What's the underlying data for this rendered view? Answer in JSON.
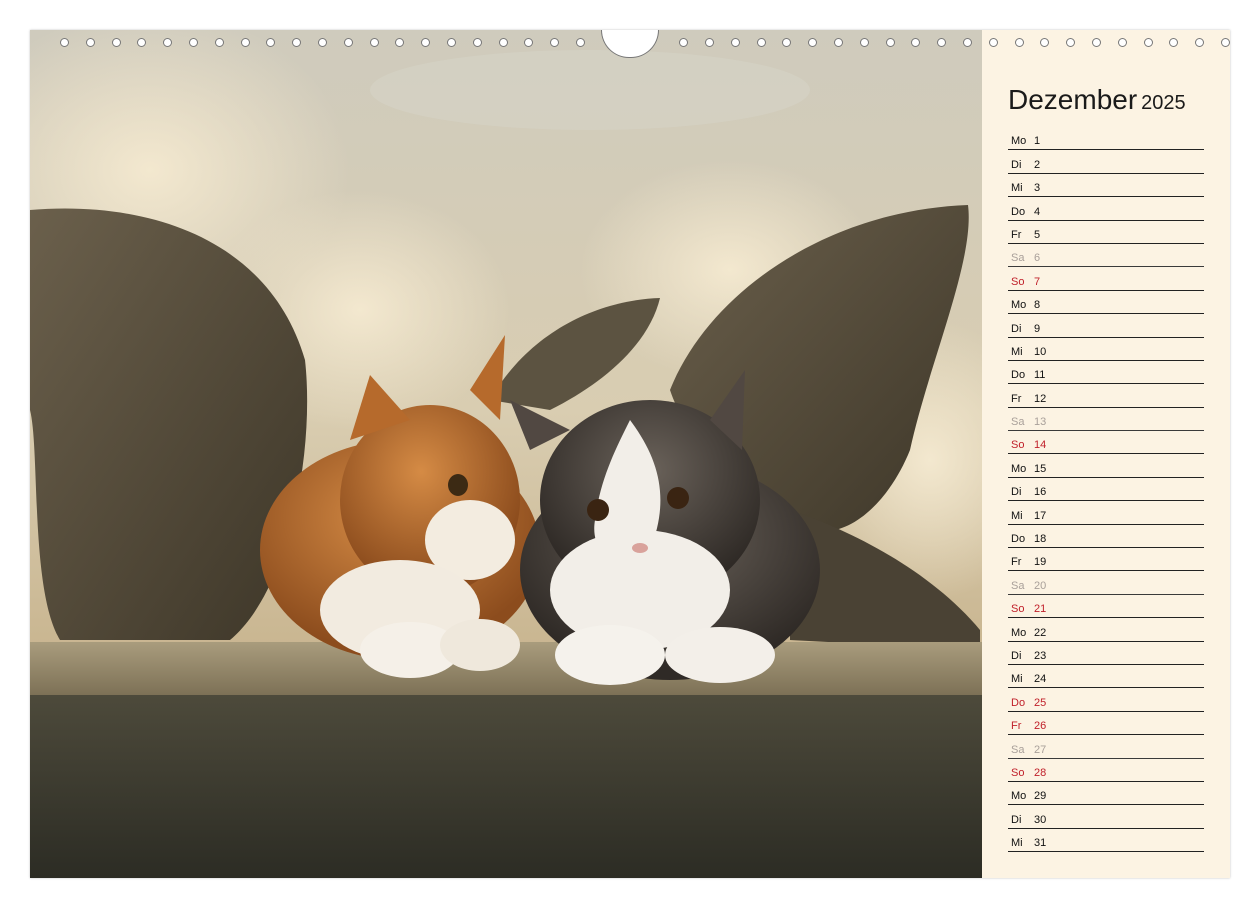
{
  "calendar": {
    "month": "Dezember",
    "year": "2025",
    "days": [
      {
        "wd": "Mo",
        "n": "1",
        "type": "normal"
      },
      {
        "wd": "Di",
        "n": "2",
        "type": "normal"
      },
      {
        "wd": "Mi",
        "n": "3",
        "type": "normal"
      },
      {
        "wd": "Do",
        "n": "4",
        "type": "normal"
      },
      {
        "wd": "Fr",
        "n": "5",
        "type": "normal"
      },
      {
        "wd": "Sa",
        "n": "6",
        "type": "sat"
      },
      {
        "wd": "So",
        "n": "7",
        "type": "red"
      },
      {
        "wd": "Mo",
        "n": "8",
        "type": "normal"
      },
      {
        "wd": "Di",
        "n": "9",
        "type": "normal"
      },
      {
        "wd": "Mi",
        "n": "10",
        "type": "normal"
      },
      {
        "wd": "Do",
        "n": "11",
        "type": "normal"
      },
      {
        "wd": "Fr",
        "n": "12",
        "type": "normal"
      },
      {
        "wd": "Sa",
        "n": "13",
        "type": "sat"
      },
      {
        "wd": "So",
        "n": "14",
        "type": "red"
      },
      {
        "wd": "Mo",
        "n": "15",
        "type": "normal"
      },
      {
        "wd": "Di",
        "n": "16",
        "type": "normal"
      },
      {
        "wd": "Mi",
        "n": "17",
        "type": "normal"
      },
      {
        "wd": "Do",
        "n": "18",
        "type": "normal"
      },
      {
        "wd": "Fr",
        "n": "19",
        "type": "normal"
      },
      {
        "wd": "Sa",
        "n": "20",
        "type": "sat"
      },
      {
        "wd": "So",
        "n": "21",
        "type": "red"
      },
      {
        "wd": "Mo",
        "n": "22",
        "type": "normal"
      },
      {
        "wd": "Di",
        "n": "23",
        "type": "normal"
      },
      {
        "wd": "Mi",
        "n": "24",
        "type": "normal"
      },
      {
        "wd": "Do",
        "n": "25",
        "type": "red"
      },
      {
        "wd": "Fr",
        "n": "26",
        "type": "red"
      },
      {
        "wd": "Sa",
        "n": "27",
        "type": "sat"
      },
      {
        "wd": "So",
        "n": "28",
        "type": "red"
      },
      {
        "wd": "Mo",
        "n": "29",
        "type": "normal"
      },
      {
        "wd": "Di",
        "n": "30",
        "type": "normal"
      },
      {
        "wd": "Mi",
        "n": "31",
        "type": "normal"
      }
    ]
  },
  "colors": {
    "panel_bg": "#fcf3e3",
    "holiday_red": "#c0202a",
    "saturday_gray": "#a9a09a"
  },
  "binding": {
    "hole_count": 46
  }
}
